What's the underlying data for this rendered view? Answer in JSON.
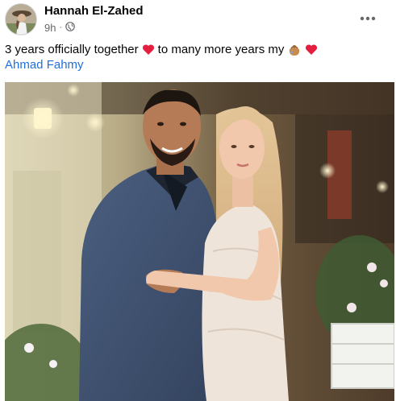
{
  "post": {
    "author": "Hannah El-Zahed",
    "time": "9h",
    "audience_icon": "globe-icon",
    "menu_icon": "more-horizontal-icon",
    "caption_part1": "3 years officially together",
    "caption_part2": "to many more years my",
    "tagged_person": "Ahmad Fahmy",
    "emojis": [
      "red-heart-icon",
      "gift-pouch-icon",
      "red-heart-icon"
    ],
    "photo_description_icon": "couple-photo"
  },
  "colors": {
    "author_text": "#050505",
    "meta_text": "#65676b",
    "link": "#216fdb",
    "heart": "#e41e3f"
  }
}
